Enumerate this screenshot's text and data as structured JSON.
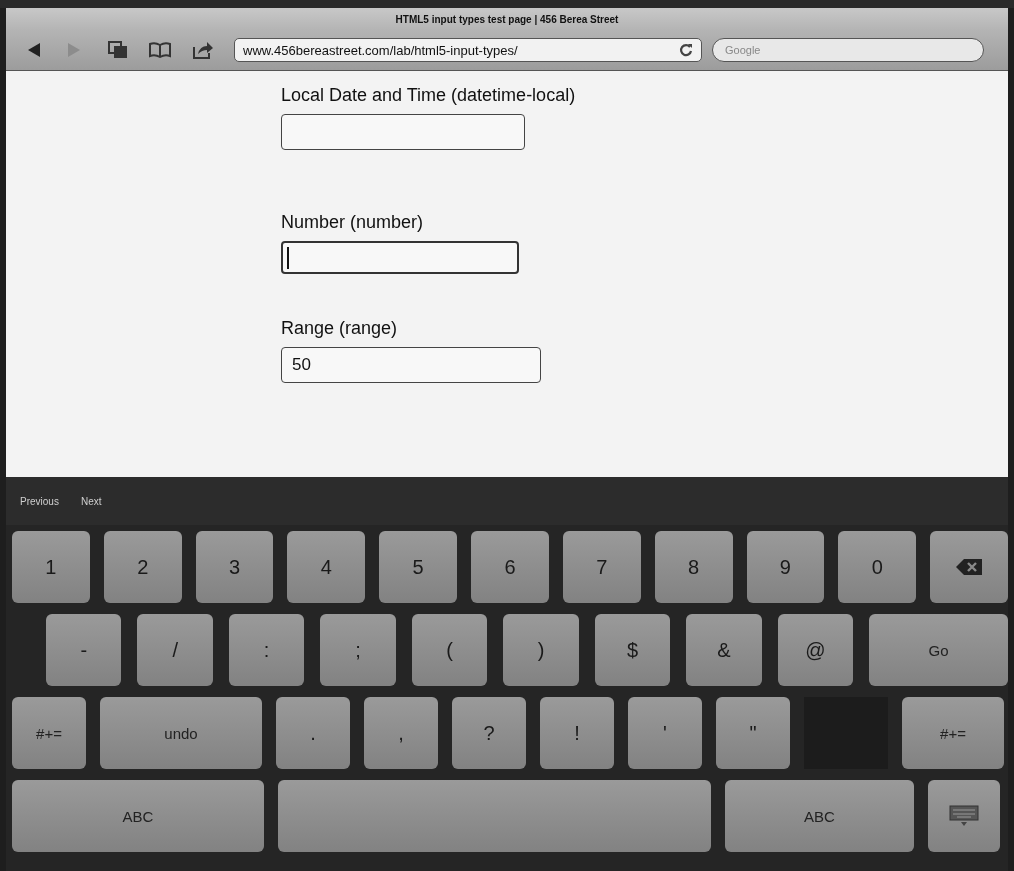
{
  "browser": {
    "title": "HTML5 input types test page | 456 Berea Street",
    "back_disabled": false,
    "forward_disabled": true,
    "url": "www.456bereastreet.com/lab/html5-input-types/",
    "search_placeholder": "Google"
  },
  "form": [
    {
      "label": "Local Date and Time (datetime-local)",
      "focused": false
    },
    {
      "label": "Number (number)",
      "focused": true
    },
    {
      "label": "Range (range)",
      "value": "50",
      "focused": false
    }
  ],
  "keyboard": {
    "toolbar": [
      "Previous",
      "Next"
    ],
    "rows": [
      {
        "keys": [
          {
            "kind": "char",
            "label": "1"
          },
          {
            "kind": "char",
            "label": "2"
          },
          {
            "kind": "char",
            "label": "3"
          },
          {
            "kind": "char",
            "label": "4"
          },
          {
            "kind": "char",
            "label": "5"
          },
          {
            "kind": "char",
            "label": "6"
          },
          {
            "kind": "char",
            "label": "7"
          },
          {
            "kind": "char",
            "label": "8"
          },
          {
            "kind": "char",
            "label": "9"
          },
          {
            "kind": "char",
            "label": "0"
          },
          {
            "kind": "delete"
          }
        ]
      },
      {
        "keys": [
          {
            "kind": "char",
            "label": "-"
          },
          {
            "kind": "char",
            "label": "/"
          },
          {
            "kind": "char",
            "label": ":"
          },
          {
            "kind": "char",
            "label": ";"
          },
          {
            "kind": "char",
            "label": "("
          },
          {
            "kind": "char",
            "label": ")"
          },
          {
            "kind": "char",
            "label": "$"
          },
          {
            "kind": "char",
            "label": "&"
          },
          {
            "kind": "char",
            "label": "@"
          },
          {
            "kind": "action",
            "label": "Go"
          }
        ]
      },
      {
        "keys": [
          {
            "kind": "action",
            "label": "#+="
          },
          {
            "kind": "action",
            "label": "undo"
          },
          {
            "kind": "char",
            "label": "."
          },
          {
            "kind": "char",
            "label": ","
          },
          {
            "kind": "char",
            "label": "?"
          },
          {
            "kind": "char",
            "label": "!"
          },
          {
            "kind": "char",
            "label": "'"
          },
          {
            "kind": "char",
            "label": "\""
          },
          {
            "kind": "blank"
          },
          {
            "kind": "action",
            "label": "#+="
          }
        ]
      },
      {
        "keys": [
          {
            "kind": "action",
            "label": "ABC"
          },
          {
            "kind": "space"
          },
          {
            "kind": "action",
            "label": "ABC"
          },
          {
            "kind": "hide"
          }
        ]
      }
    ]
  }
}
